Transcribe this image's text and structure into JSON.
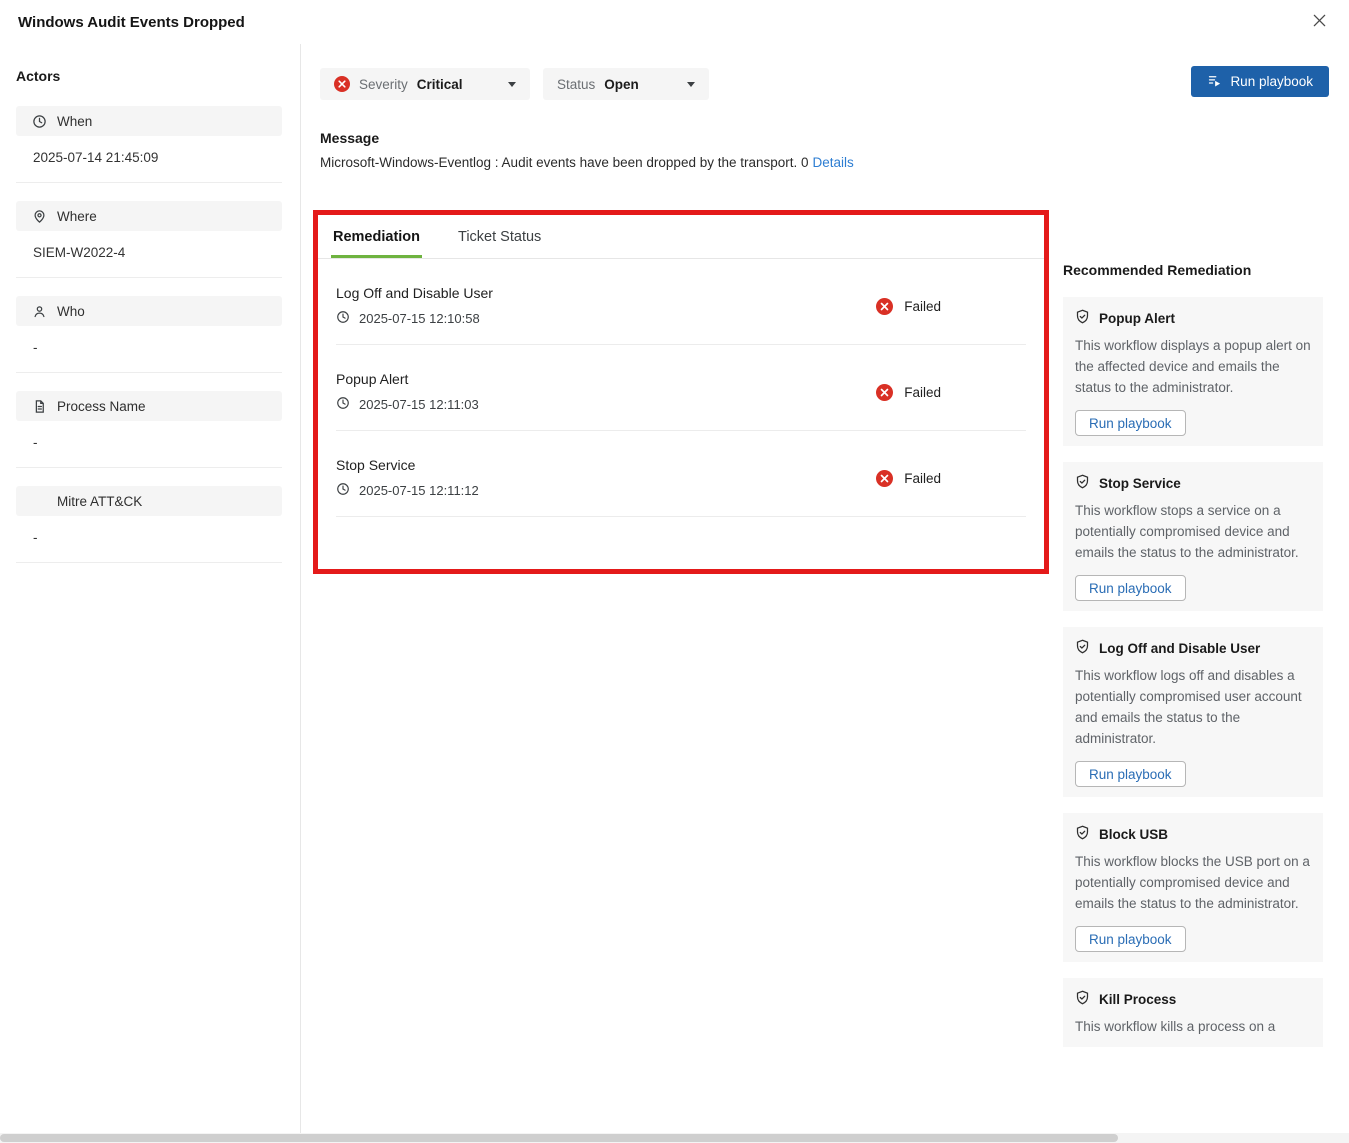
{
  "header": {
    "title": "Windows Audit Events Dropped"
  },
  "actors": {
    "title": "Actors",
    "fields": [
      {
        "icon": "clock-icon",
        "label": "When",
        "value": "2025-07-14 21:45:09"
      },
      {
        "icon": "location-pin-icon",
        "label": "Where",
        "value": "SIEM-W2022-4"
      },
      {
        "icon": "person-icon",
        "label": "Who",
        "value": "-"
      },
      {
        "icon": "document-icon",
        "label": "Process Name",
        "value": "-"
      },
      {
        "icon": "none",
        "label": "Mitre ATT&CK",
        "value": "-"
      }
    ]
  },
  "filters": {
    "severity": {
      "label": "Severity",
      "value": "Critical",
      "icon": "critical-error-icon"
    },
    "status": {
      "label": "Status",
      "value": "Open"
    }
  },
  "run_playbook_label": "Run playbook",
  "message": {
    "heading": "Message",
    "text": "Microsoft-Windows-Eventlog : Audit events have been dropped by the transport. 0",
    "details_link": "Details"
  },
  "tabs": [
    {
      "label": "Remediation",
      "active": true
    },
    {
      "label": "Ticket Status",
      "active": false
    }
  ],
  "remediation_items": [
    {
      "title": "Log Off and Disable User",
      "timestamp": "2025-07-15 12:10:58",
      "status": "Failed"
    },
    {
      "title": "Popup Alert",
      "timestamp": "2025-07-15 12:11:03",
      "status": "Failed"
    },
    {
      "title": "Stop Service",
      "timestamp": "2025-07-15 12:11:12",
      "status": "Failed"
    }
  ],
  "recommended": {
    "title": "Recommended Remediation",
    "run_label": "Run playbook",
    "cards": [
      {
        "title": "Popup Alert",
        "description": "This workflow displays a popup alert on the affected device and emails the status to the administrator."
      },
      {
        "title": "Stop Service",
        "description": "This workflow stops a service on a potentially compromised device and emails the status to the administrator."
      },
      {
        "title": "Log Off and Disable User",
        "description": "This workflow logs off and disables a potentially compromised user account and emails the status to the administrator."
      },
      {
        "title": "Block USB",
        "description": "This workflow blocks the USB port on a potentially compromised device and emails the status to the administrator."
      },
      {
        "title": "Kill Process",
        "description": "This workflow kills a process on a"
      }
    ]
  },
  "colors": {
    "primary_blue": "#1e61a9",
    "link_blue": "#2d7dd2",
    "error_red": "#d93025",
    "annotation_red": "#e41a1a",
    "tab_green": "#6eb33f",
    "card_bg": "#f7f7f7",
    "chip_bg": "#f5f5f5"
  }
}
